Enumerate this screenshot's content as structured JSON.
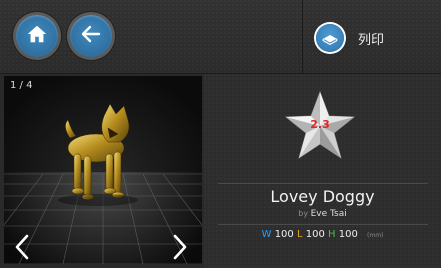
{
  "toolbar": {
    "home_icon": "home-icon",
    "back_icon": "arrow-left-icon",
    "print_icon": "print-icon",
    "print_label": "列印",
    "accent_color": "#3a84bc"
  },
  "viewer": {
    "page_indicator": "1 / 4",
    "prev_icon": "chevron-left-icon",
    "next_icon": "chevron-right-icon"
  },
  "model": {
    "rating": "2.3",
    "rating_icon": "star-icon",
    "name": "Lovey Doggy",
    "by_label": "by",
    "author": "Eve Tsai",
    "dimensions": {
      "w_label": "W",
      "w_value": "100",
      "l_label": "L",
      "l_value": "100",
      "h_label": "H",
      "h_value": "100",
      "unit": "(mm)"
    }
  }
}
